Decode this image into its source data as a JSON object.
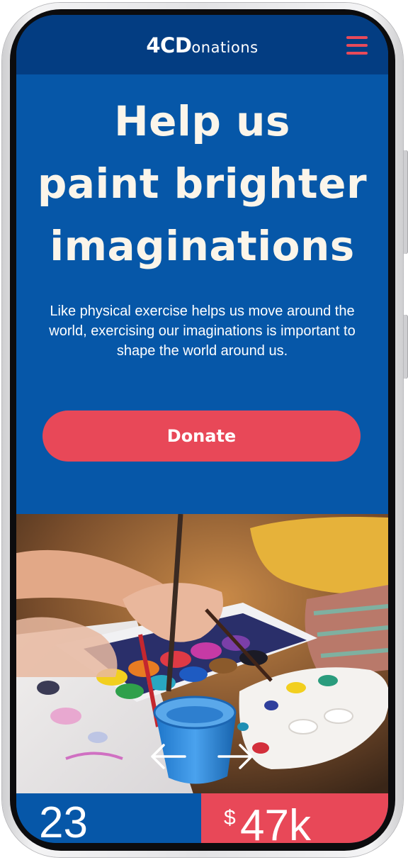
{
  "header": {
    "logo_bold": "4CD",
    "logo_light": "onations",
    "menu_icon": "hamburger-icon"
  },
  "hero": {
    "title_lines": [
      "Help us",
      "paint brighter",
      "imaginations"
    ],
    "subtitle": "Like physical exercise helps us move around the world, exercising our imaginations is important to shape the world around us.",
    "donate_label": "Donate"
  },
  "carousel": {
    "prev_icon": "arrow-left-icon",
    "next_icon": "arrow-right-icon"
  },
  "stats": {
    "left_value": "23",
    "right_currency": "$",
    "right_value": "47k"
  },
  "colors": {
    "header_bg": "#033d82",
    "hero_bg": "#0657a8",
    "accent": "#e84858",
    "title_text": "#fbf5ea"
  }
}
